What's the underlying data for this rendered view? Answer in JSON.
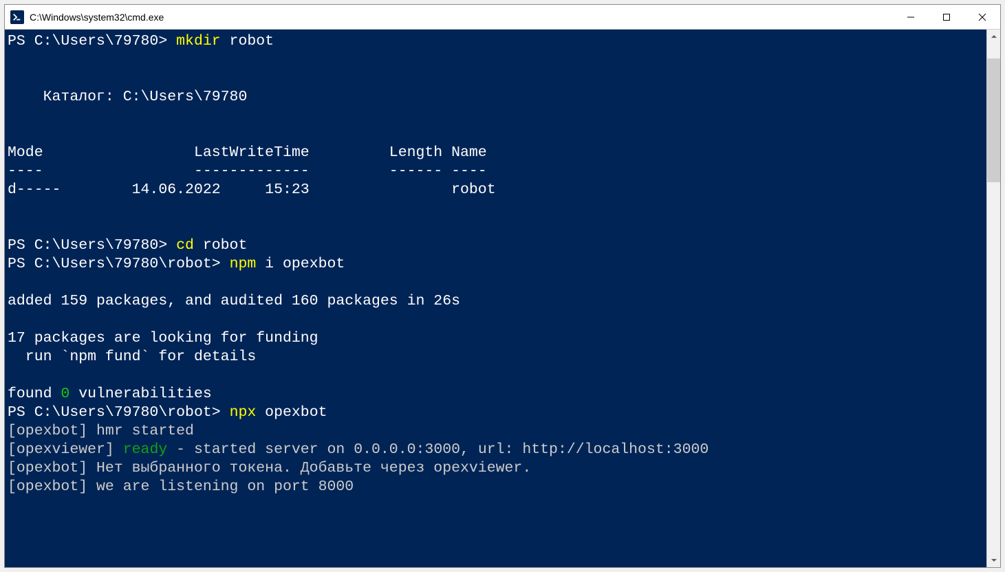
{
  "titlebar": {
    "title": "C:\\Windows\\system32\\cmd.exe"
  },
  "terminal": {
    "line1_prompt": "PS C:\\Users\\79780> ",
    "line1_cmd": "mkdir",
    "line1_arg": " robot",
    "blank1": "",
    "blank2": "",
    "catalog_line": "    Каталог: C:\\Users\\79780",
    "blank3": "",
    "blank4": "",
    "header_line": "Mode                 LastWriteTime         Length Name",
    "divider_line": "----                 -------------         ------ ----",
    "data_row": "d-----        14.06.2022     15:23                robot",
    "blank5": "",
    "blank6": "",
    "line2_prompt": "PS C:\\Users\\79780> ",
    "line2_cmd": "cd",
    "line2_arg": " robot",
    "line3_prompt": "PS C:\\Users\\79780\\robot> ",
    "line3_cmd": "npm",
    "line3_arg": " i opexbot",
    "blank7": "",
    "added_line": "added 159 packages, and audited 160 packages in 26s",
    "blank8": "",
    "funding1": "17 packages are looking for funding",
    "funding2": "  run `npm fund` for details",
    "blank9": "",
    "vuln_prefix": "found ",
    "vuln_zero": "0",
    "vuln_suffix": " vulnerabilities",
    "line4_prompt": "PS C:\\Users\\79780\\robot> ",
    "line4_cmd": "npx",
    "line4_arg": " opexbot",
    "hmr_line": "[opexbot] hmr started",
    "viewer_prefix": "[opexviewer] ",
    "viewer_ready": "ready",
    "viewer_suffix": " - started server on 0.0.0.0:3000, url: http://localhost:3000",
    "token_line": "[opexbot] Нет выбранного токена. Добавьте через opexviewer.",
    "listen_line": "[opexbot] we are listening on port 8000"
  }
}
